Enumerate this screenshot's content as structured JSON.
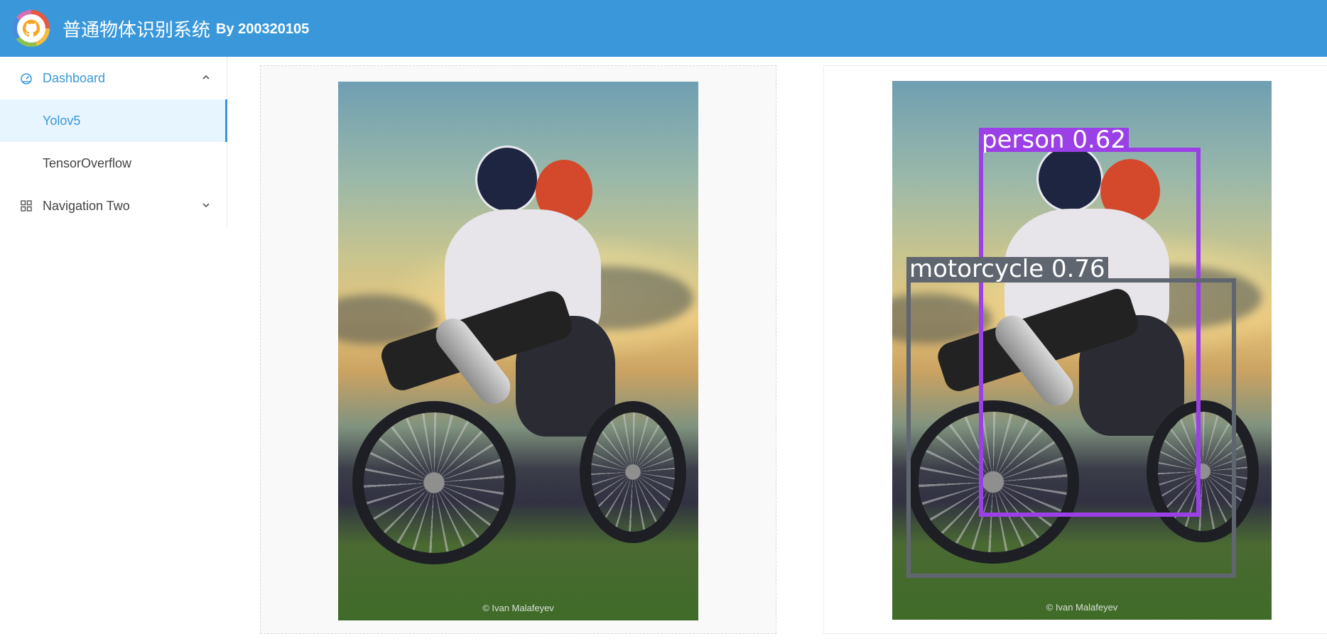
{
  "header": {
    "title": "普通物体识别系统",
    "subtitle": "By 200320105",
    "bg_color": "#3a98da"
  },
  "sidebar": {
    "items": [
      {
        "label": "Dashboard",
        "icon": "dashboard-icon",
        "expanded": true
      },
      {
        "label": "Yolov5",
        "active": true
      },
      {
        "label": "TensorOverflow"
      },
      {
        "label": "Navigation Two",
        "icon": "grid-icon",
        "expanded": false
      }
    ]
  },
  "main": {
    "original_image": {
      "credit": "© Ivan Malafeyev"
    },
    "result_image": {
      "credit": "© Ivan Malafeyev",
      "detections": [
        {
          "label": "person 0.62",
          "color": "#9b3fe6"
        },
        {
          "label": "motorcycle 0.76",
          "color": "#5f6670"
        }
      ]
    }
  },
  "colors": {
    "accent": "#3a98da",
    "active_bg": "#e6f5ff"
  }
}
